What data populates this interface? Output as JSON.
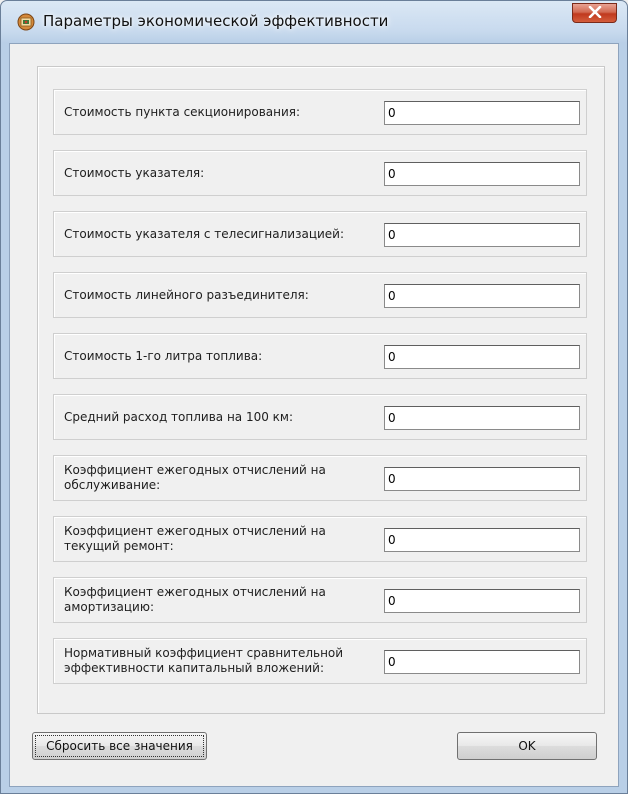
{
  "window": {
    "title": "Параметры экономической эффективности",
    "close_label": "X"
  },
  "fields": [
    {
      "label": "Стоимость пункта секционирования:",
      "value": "0"
    },
    {
      "label": "Стоимость указателя:",
      "value": "0"
    },
    {
      "label": "Стоимость указателя с телесигнализацией:",
      "value": "0"
    },
    {
      "label": "Стоимость линейного разъединителя:",
      "value": "0"
    },
    {
      "label": "Стоимость 1-го литра топлива:",
      "value": "0"
    },
    {
      "label": "Средний расход топлива на 100 км:",
      "value": "0"
    },
    {
      "label": "Коэффициент ежегодных отчислений на обслуживание:",
      "value": "0"
    },
    {
      "label": "Коэффициент ежегодных отчислений на текущий ремонт:",
      "value": "0"
    },
    {
      "label": "Коэффициент ежегодных отчислений на амортизацию:",
      "value": "0"
    },
    {
      "label": "Нормативный коэффициент сравнительной эффективности капитальный вложений:",
      "value": "0"
    }
  ],
  "buttons": {
    "reset_label": "Сбросить все значения",
    "ok_label": "OK"
  }
}
